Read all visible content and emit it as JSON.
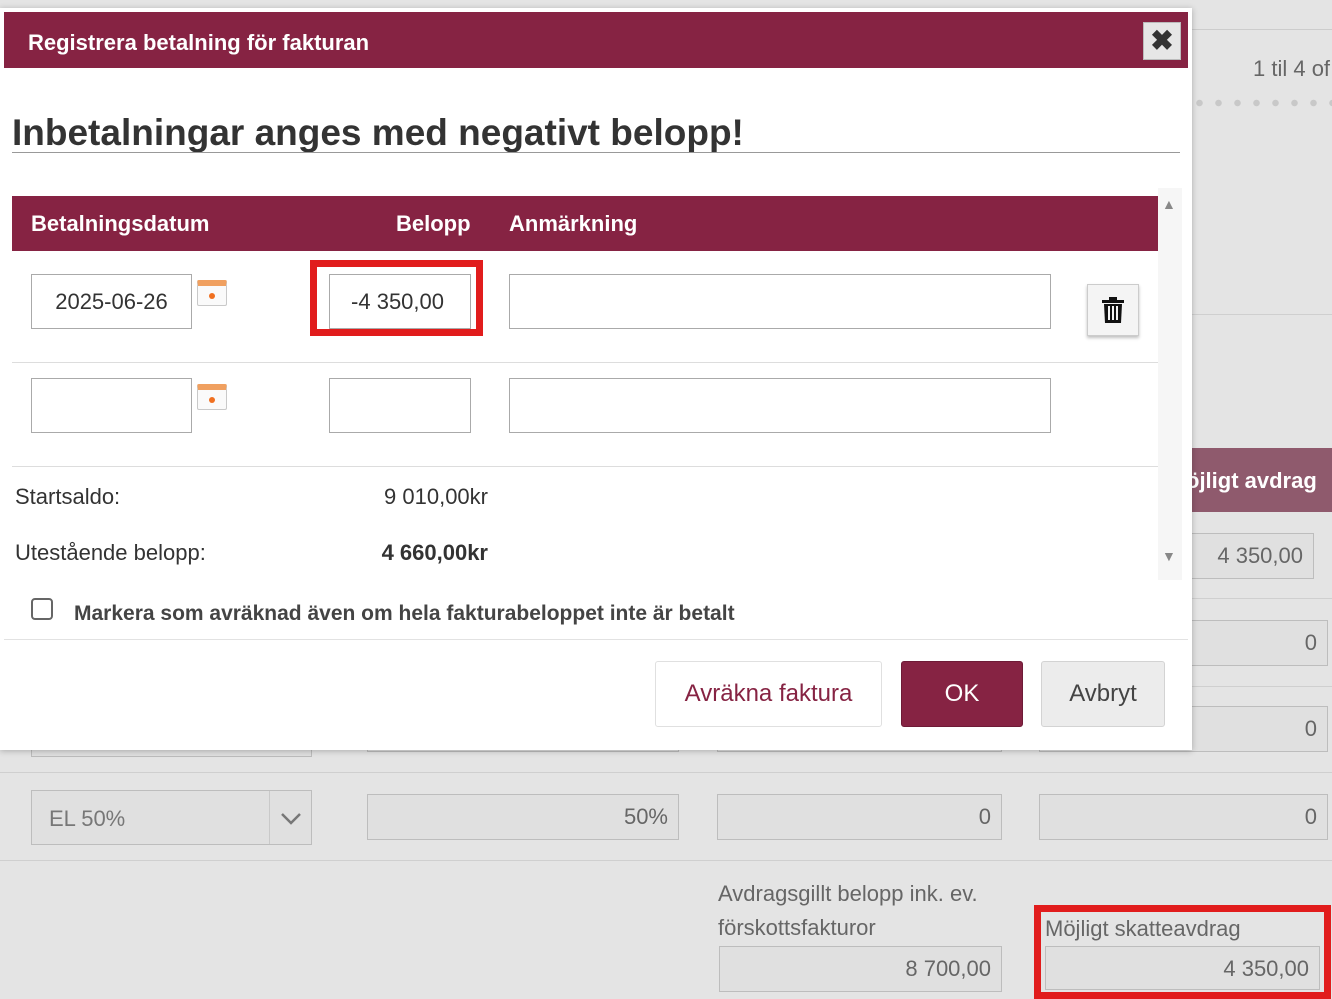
{
  "background": {
    "pager_text": "1 til 4 of",
    "column_header": "öjligt avdrag",
    "rows": [
      {
        "col4": "4 350,00"
      },
      {
        "col4": "0"
      },
      {
        "col4": "0"
      },
      {
        "select": "EL 50%",
        "percent": "50%",
        "col3": "0",
        "col4": "0"
      }
    ],
    "deductible_label": "Avdragsgillt belopp ink. ev. förskottsfakturor",
    "deductible_value": "8 700,00",
    "possible_deduction_label": "Möjligt skatteavdrag",
    "possible_deduction_value": "4 350,00"
  },
  "modal": {
    "title": "Registrera betalning för fakturan",
    "warning": "Inbetalningar anges med negativt belopp!",
    "columns": {
      "date": "Betalningsdatum",
      "amount": "Belopp",
      "note": "Anmärkning"
    },
    "payments": [
      {
        "date": "2025-06-26",
        "amount": "-4 350,00",
        "note": ""
      },
      {
        "date": "",
        "amount": "",
        "note": ""
      }
    ],
    "start_balance_label": "Startsaldo:",
    "start_balance_value": "9 010,00kr",
    "outstanding_label": "Utestående belopp:",
    "outstanding_value": "4 660,00kr",
    "checkbox_label": "Markera som avräknad även om hela fakturabeloppet inte är betalt",
    "checkbox_checked": false,
    "buttons": {
      "settle": "Avräkna faktura",
      "ok": "OK",
      "cancel": "Avbryt"
    }
  },
  "icons": {
    "close": "close-icon",
    "calendar": "calendar-icon",
    "delete": "trash-icon",
    "scroll_up": "arrow-up-icon",
    "scroll_down": "arrow-down-icon",
    "select_chevron": "chevron-down-icon"
  },
  "colors": {
    "brand": "#862343",
    "highlight": "#e11c1c"
  }
}
